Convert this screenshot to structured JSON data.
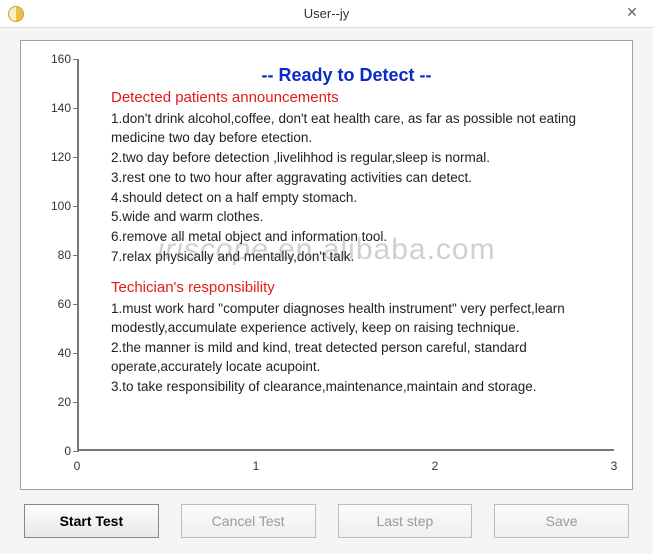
{
  "window": {
    "title": "User--jy",
    "close_glyph": "✕"
  },
  "chart_data": {
    "type": "line",
    "x_ticks": [
      0,
      1,
      2,
      3
    ],
    "y_ticks": [
      0,
      20,
      40,
      60,
      80,
      100,
      120,
      140,
      160
    ],
    "xlim": [
      0,
      3
    ],
    "ylim": [
      0,
      160
    ],
    "series": [],
    "title": "-- Ready to Detect --"
  },
  "sections": {
    "patient": {
      "header": "Detected patients announcements",
      "lines": [
        "1.don't drink alcohol,coffee, don't eat health care, as far as possible not eating medicine two day before etection.",
        "2.two day before detection ,livelihhod is regular,sleep is normal.",
        "3.rest one to two hour after aggravating activities can detect.",
        "4.should detect on a half empty stomach.",
        "5.wide and warm clothes.",
        "6.remove all metal object and information tool.",
        "7.relax physically and mentally,don't talk."
      ]
    },
    "technician": {
      "header": "Techician's responsibility",
      "lines": [
        "1.must work hard \"computer diagnoses health instrument\" very perfect,learn modestly,accumulate experience actively, keep on raising technique.",
        "2.the manner is mild and kind, treat detected person careful, standard operate,accurately locate acupoint.",
        "3.to take responsibility of clearance,maintenance,maintain and storage."
      ]
    }
  },
  "watermark": {
    "left": "iriscope",
    "right": ".en.alibaba.com"
  },
  "buttons": {
    "start": "Start Test",
    "cancel": "Cancel Test",
    "last": "Last step",
    "save": "Save"
  }
}
